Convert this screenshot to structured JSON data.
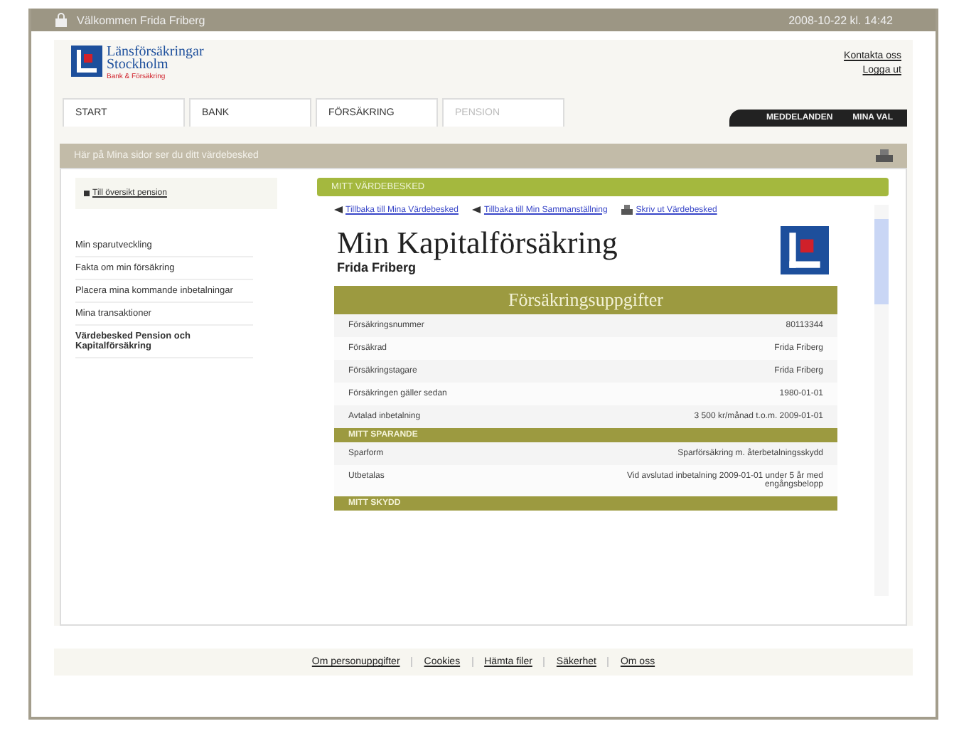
{
  "top_bar": {
    "welcome": "Välkommen Frida Friberg",
    "datetime": "2008-10-22 kl. 14:42"
  },
  "logo": {
    "name": "Länsförsäkringar",
    "city": "Stockholm",
    "tagline": "Bank & Försäkring"
  },
  "header_links": [
    "Kontakta oss",
    "Logga ut"
  ],
  "tabs": [
    {
      "label": "START",
      "selected": false
    },
    {
      "label": "BANK",
      "selected": false
    },
    {
      "label": "FÖRSÄKRING",
      "selected": false
    },
    {
      "label": "PENSION",
      "selected": true
    }
  ],
  "dark_tabs": [
    "MEDDELANDEN",
    "MINA VAL"
  ],
  "breadcrumb": "Här på Mina sidor ser du ditt värdebesked",
  "sidebar": {
    "back_link": "Till översikt pension",
    "items": [
      {
        "label": "Min sparutveckling",
        "selected": false
      },
      {
        "label": "Fakta om min försäkring",
        "selected": false
      },
      {
        "label": "Placera mina kommande inbetalningar",
        "selected": false
      },
      {
        "label": "Mina transaktioner",
        "selected": false
      },
      {
        "label": "Värdebesked Pension och Kapitalförsäkring",
        "selected": true
      }
    ]
  },
  "panel": {
    "header": "MITT VÄRDEBESKED",
    "links": [
      {
        "kind": "back",
        "label": "Tillbaka till Mina Värdebesked"
      },
      {
        "kind": "back",
        "label": "Tillbaka till Min Sammanställning"
      },
      {
        "kind": "print",
        "label": "Skriv ut Värdebesked"
      }
    ],
    "title": "Min Kapitalförsäkring",
    "subtitle": "Frida Friberg",
    "table": {
      "title": "Försäkringsuppgifter",
      "rows": [
        {
          "kind": "row",
          "label": "Försäkringsnummer",
          "value": "80113344"
        },
        {
          "kind": "row",
          "label": "Försäkrad",
          "value": "Frida Friberg"
        },
        {
          "kind": "row",
          "label": "Försäkringstagare",
          "value": "Frida Friberg"
        },
        {
          "kind": "row",
          "label": "Försäkringen gäller sedan",
          "value": "1980-01-01"
        },
        {
          "kind": "row",
          "label": "Avtalad inbetalning",
          "value": "3 500 kr/månad t.o.m. 2009-01-01"
        },
        {
          "kind": "section",
          "label": "MITT SPARANDE"
        },
        {
          "kind": "row",
          "label": "Sparform",
          "value": "Sparförsäkring m. återbetalningsskydd"
        },
        {
          "kind": "row",
          "label": "Utbetalas",
          "value": "Vid avslutad inbetalning 2009-01-01 under 5 år med engångsbelopp"
        },
        {
          "kind": "section",
          "label": "MITT SKYDD"
        }
      ]
    }
  },
  "footer_links": [
    "Om personuppgifter",
    "Cookies",
    "Hämta filer",
    "Säkerhet",
    "Om oss"
  ]
}
